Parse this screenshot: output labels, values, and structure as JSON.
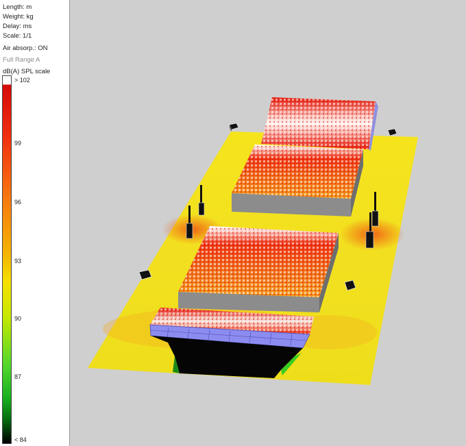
{
  "info": {
    "length": "Length: m",
    "weight": "Weight: kg",
    "delay": "Delay: ms",
    "scale": "Scale: 1/1",
    "air": "Air absorp.: ON",
    "band": "Full Range A",
    "scale_title": "dB(A) SPL scale"
  },
  "scale_ticks": [
    "> 102",
    "99",
    "96",
    "93",
    "90",
    "87",
    "< 84"
  ],
  "colors": {
    "panel_bg": "#ffffff",
    "viewport_bg": "#cfcfcf",
    "floor_yellow": "#f4e21a",
    "hot_red": "#e81a0a",
    "warm_orange": "#f58a1a",
    "stage_blue": "#8c8cf0",
    "stand_gray": "#8c8c8c"
  },
  "scene": {
    "objects": [
      "floor-plane",
      "rear-stand",
      "upper-platform",
      "lower-platform",
      "front-stage",
      "line-array-left-rear",
      "line-array-left-front",
      "line-array-right-rear",
      "line-array-right-front",
      "speaker-box-back-left",
      "speaker-box-back-right",
      "speaker-box-mid-left",
      "speaker-box-mid-right"
    ]
  }
}
